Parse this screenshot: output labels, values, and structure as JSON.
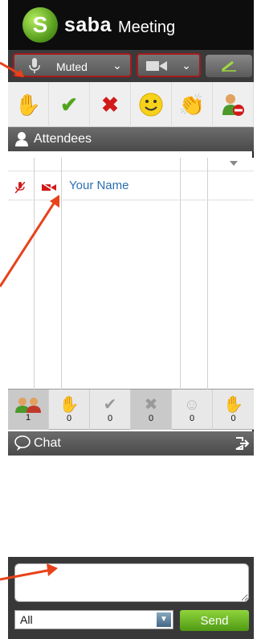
{
  "brand": {
    "logo_letter": "S",
    "name": "saba",
    "product": "Meeting"
  },
  "controls": {
    "mic_label": "Muted",
    "mic_icon": "microphone-icon",
    "camera_icon": "video-camera-icon",
    "whiteboard_icon": "pencil-icon"
  },
  "reactions": [
    {
      "icon": "raise-hand-icon"
    },
    {
      "icon": "checkmark-icon"
    },
    {
      "icon": "x-icon"
    },
    {
      "icon": "smiley-icon"
    },
    {
      "icon": "applause-icon"
    },
    {
      "icon": "leave-user-icon"
    }
  ],
  "attendees": {
    "header": "Attendees",
    "rows": [
      {
        "name": "Your Name",
        "mic": "muted",
        "camera": "off"
      }
    ]
  },
  "counts": [
    {
      "icon": "users-icon",
      "value": "1"
    },
    {
      "icon": "raise-hand-icon",
      "value": "0"
    },
    {
      "icon": "checkmark-icon",
      "value": "0"
    },
    {
      "icon": "x-icon",
      "value": "0"
    },
    {
      "icon": "smiley-icon",
      "value": "0"
    },
    {
      "icon": "applause-icon",
      "value": "0"
    }
  ],
  "chat": {
    "header": "Chat",
    "input_value": "",
    "recipient": "All",
    "send_label": "Send"
  },
  "colors": {
    "accent_green": "#4f9a14",
    "muted_red": "#a51a1a",
    "link_blue": "#2b6fb0"
  }
}
